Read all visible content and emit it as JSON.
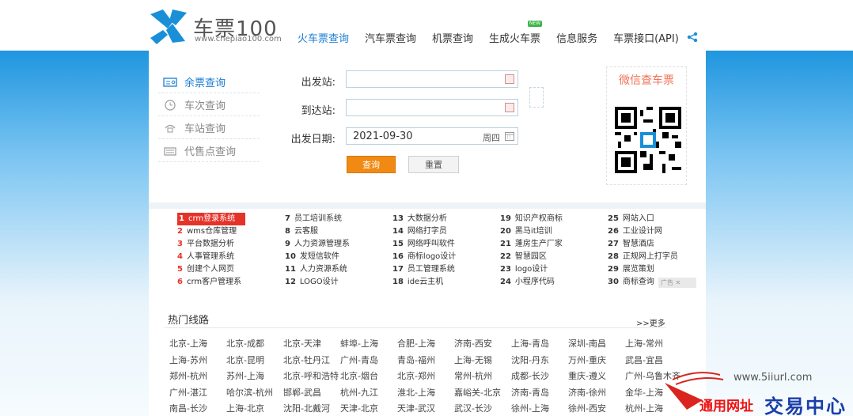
{
  "header": {
    "logo_text": "车票100",
    "logo_sub": "www.chepiao100.com",
    "nav": [
      {
        "label": "火车票查询",
        "active": true
      },
      {
        "label": "汽车票查询"
      },
      {
        "label": "机票查询"
      },
      {
        "label": "生成火车票",
        "badge": "NEW"
      },
      {
        "label": "信息服务"
      },
      {
        "label": "车票接口(API)"
      }
    ]
  },
  "sidebar": {
    "items": [
      {
        "label": "余票查询",
        "icon": "ticket-icon",
        "active": true
      },
      {
        "label": "车次查询",
        "icon": "clock-icon"
      },
      {
        "label": "车站查询",
        "icon": "station-icon"
      },
      {
        "label": "代售点查询",
        "icon": "keyboard-icon"
      }
    ]
  },
  "form": {
    "from_label": "出发站:",
    "to_label": "到达站:",
    "date_label": "出发日期:",
    "date_value": "2021-09-30",
    "date_week": "周四",
    "query_label": "查询",
    "reset_label": "重置"
  },
  "wechat": {
    "title": "微信查车票"
  },
  "ads": {
    "columns": [
      [
        {
          "n": "1",
          "t": "crm登录系统",
          "hl": true
        },
        {
          "n": "2",
          "t": "wms仓库管理"
        },
        {
          "n": "3",
          "t": "平台数据分析"
        },
        {
          "n": "4",
          "t": "人事管理系统"
        },
        {
          "n": "5",
          "t": "创建个人网页"
        },
        {
          "n": "6",
          "t": "crm客户管理系"
        }
      ],
      [
        {
          "n": "7",
          "t": "员工培训系统"
        },
        {
          "n": "8",
          "t": "云客服"
        },
        {
          "n": "9",
          "t": "人力资源管理系"
        },
        {
          "n": "10",
          "t": "发短信软件"
        },
        {
          "n": "11",
          "t": "人力资源系统"
        },
        {
          "n": "12",
          "t": "LOGO设计"
        }
      ],
      [
        {
          "n": "13",
          "t": "大数据分析"
        },
        {
          "n": "14",
          "t": "网络打字员"
        },
        {
          "n": "15",
          "t": "网络呼叫软件"
        },
        {
          "n": "16",
          "t": "商标logo设计"
        },
        {
          "n": "17",
          "t": "员工管理系统"
        },
        {
          "n": "18",
          "t": "ide云主机"
        }
      ],
      [
        {
          "n": "19",
          "t": "知识产权商标"
        },
        {
          "n": "20",
          "t": "黑马it培训"
        },
        {
          "n": "21",
          "t": "蓬房生产厂家"
        },
        {
          "n": "22",
          "t": "智慧园区"
        },
        {
          "n": "23",
          "t": "logo设计"
        },
        {
          "n": "24",
          "t": "小程序代码"
        }
      ],
      [
        {
          "n": "25",
          "t": "网站入口"
        },
        {
          "n": "26",
          "t": "工业设计网"
        },
        {
          "n": "27",
          "t": "智慧酒店"
        },
        {
          "n": "28",
          "t": "正规网上打字员"
        },
        {
          "n": "29",
          "t": "展览策划"
        },
        {
          "n": "30",
          "t": "商标查询"
        }
      ]
    ],
    "badge": "广告"
  },
  "hot": {
    "title": "热门线路",
    "more": ">>更多",
    "rows": [
      [
        "北京-上海",
        "北京-成都",
        "北京-天津",
        "蚌埠-上海",
        "合肥-上海",
        "济南-西安",
        "上海-青岛",
        "深圳-南昌",
        "上海-常州"
      ],
      [
        "上海-苏州",
        "北京-昆明",
        "北京-牡丹江",
        "广州-青岛",
        "青岛-福州",
        "上海-无锡",
        "沈阳-丹东",
        "万州-重庆",
        "武昌-宜昌"
      ],
      [
        "郑州-杭州",
        "苏州-上海",
        "北京-呼和浩特",
        "北京-烟台",
        "北京-郑州",
        "常州-杭州",
        "成都-长沙",
        "重庆-遵义",
        "广州-乌鲁木齐"
      ],
      [
        "广州-湛江",
        "哈尔滨-杭州",
        "邯郸-武昌",
        "杭州-九江",
        "淮北-上海",
        "嘉峪关-北京",
        "济南-青岛",
        "济南-徐州",
        "金华-上海"
      ],
      [
        "南昌-长沙",
        "上海-北京",
        "沈阳-北戴河",
        "天津-北京",
        "天津-武汉",
        "武汉-长沙",
        "徐州-上海",
        "徐州-西安",
        "杭州-上海"
      ]
    ]
  },
  "watermark": {
    "url": "www.5iiurl.com",
    "brand1": "通用网址",
    "brand2": "交易中心"
  }
}
